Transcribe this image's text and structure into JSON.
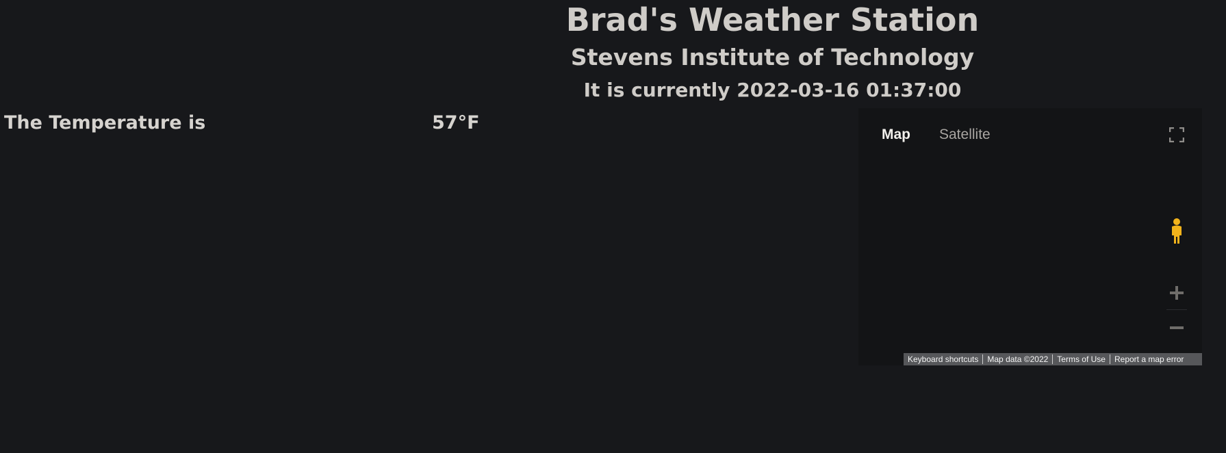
{
  "header": {
    "title": "Brad's Weather Station",
    "subtitle": "Stevens Institute of Technology",
    "current_time": "It is currently 2022-03-16 01:37:00"
  },
  "temperature": {
    "label": "The Temperature is",
    "value": "57°F"
  },
  "map": {
    "type_buttons": {
      "map": "Map",
      "satellite": "Satellite"
    },
    "selected_type": "Map",
    "icons": {
      "fullscreen": "fullscreen-icon",
      "pegman": "pegman-icon",
      "zoom_in": "plus-icon",
      "zoom_out": "minus-icon"
    },
    "attribution": {
      "keyboard_shortcuts": "Keyboard shortcuts",
      "map_data": "Map data ©2022",
      "terms": "Terms of Use",
      "report": "Report a map error"
    }
  },
  "colors": {
    "background": "#17181b",
    "text": "#d9d6d2",
    "pegman": "#f2b31b"
  }
}
